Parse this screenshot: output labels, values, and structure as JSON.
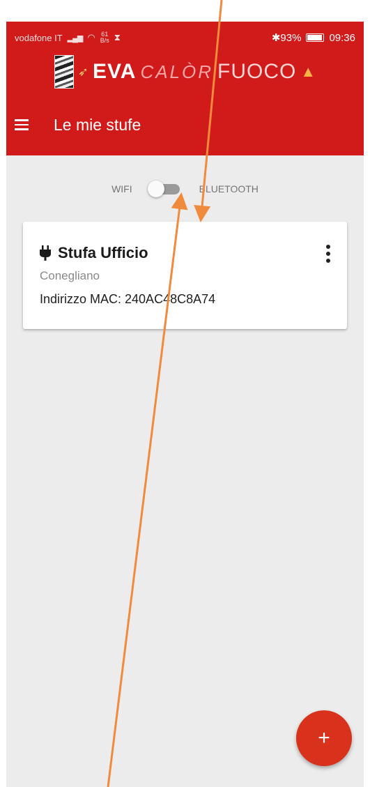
{
  "status_bar": {
    "carrier": "vodafone IT",
    "net_speed_value": "61",
    "net_speed_unit": "B/s",
    "bluetooth_battery": "✱93%",
    "time": "09:36"
  },
  "brand": {
    "eva": "EVA",
    "calor": "CALÒR",
    "fuoco": "FUOCO"
  },
  "toolbar": {
    "title": "Le mie stufe"
  },
  "connection_toggle": {
    "left_label": "WIFI",
    "right_label": "BLUETOOTH",
    "selected": "WIFI"
  },
  "stoves": [
    {
      "name": "Stufa Ufficio",
      "location": "Conegliano",
      "mac_label": "Indirizzo MAC: 240AC48C8A74"
    }
  ],
  "fab": {
    "label": "+"
  },
  "colors": {
    "primary": "#d11a1a",
    "fab": "#d8311c",
    "background": "#ececec",
    "annotation_arrow": "#f08a3c"
  },
  "icons": {
    "menu": "menu-icon",
    "plug": "plug-icon",
    "more": "more-vert-icon",
    "add": "add-icon"
  }
}
